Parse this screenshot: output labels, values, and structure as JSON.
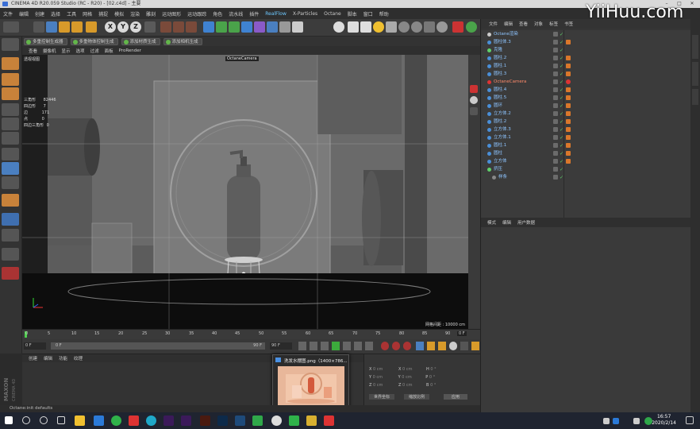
{
  "window": {
    "title": "CINEMA 4D R20.059 Studio (RC - R20) - [02.c4d] - 主要",
    "watermark": "YiiHuu.com"
  },
  "menubar": [
    "文件",
    "编辑",
    "创建",
    "选择",
    "工具",
    "网格",
    "捕捉",
    "模拟",
    "渲染",
    "雕刻",
    "运动图形",
    "运动跟踪",
    "角色",
    "流水线",
    "插件",
    "RealFlow",
    "X-Particles",
    "Octane",
    "脚本",
    "窗口",
    "帮助"
  ],
  "subtoolbar": [
    "多重控制生成器",
    "多重物体控制生成",
    "添加材质生成",
    "添加相机生成"
  ],
  "viewport": {
    "menu": [
      "查看",
      "摄像机",
      "显示",
      "选项",
      "过滤",
      "面板",
      "ProRender"
    ],
    "view_name": "透视视图",
    "camera_label": "OctaneCamera",
    "grid_distance": "网格间距 : 10000 cm",
    "stats": [
      {
        "label": "三角形",
        "value": "82446"
      },
      {
        "label": "四边形",
        "value": "7"
      },
      {
        "label": "边",
        "value": "171"
      },
      {
        "label": "点",
        "value": "0"
      },
      {
        "label": "四边三角形",
        "value": "0"
      }
    ],
    "colors": {
      "bg": "#000000",
      "wall": "#6e6e6e",
      "floor": "#141414"
    }
  },
  "timeline": {
    "ticks": [
      "0",
      "5",
      "10",
      "15",
      "20",
      "25",
      "30",
      "35",
      "40",
      "45",
      "50",
      "55",
      "60",
      "65",
      "70",
      "75",
      "80",
      "85",
      "90"
    ],
    "current_frame": "0 F",
    "start_field": "0 F",
    "start_field2": "0 F",
    "end_field": "90 F",
    "end_field2": "90 F"
  },
  "material_panel": {
    "menu": [
      "创建",
      "编辑",
      "功能",
      "纹理"
    ]
  },
  "coordinates": {
    "rows": [
      {
        "a": "X",
        "av": "0 cm",
        "b": "X",
        "bv": "0 cm",
        "c": "H",
        "cv": "0 °"
      },
      {
        "a": "Y",
        "av": "0 cm",
        "b": "Y",
        "bv": "0 cm",
        "c": "P",
        "cv": "0 °"
      },
      {
        "a": "Z",
        "av": "0 cm",
        "b": "Z",
        "bv": "0 cm",
        "c": "B",
        "cv": "0 °"
      }
    ],
    "mode1": "世界坐标",
    "mode2": "缩放比例",
    "apply": "应用"
  },
  "popup": {
    "title": "洗发水摆图.png（1400×786..."
  },
  "object_manager": {
    "menu": [
      "文件",
      "编辑",
      "查看",
      "对象",
      "标签",
      "书签"
    ],
    "items": [
      {
        "name": "Octane渲染",
        "indent": 0
      },
      {
        "name": "圆柱体.3",
        "indent": 0
      },
      {
        "name": "克隆",
        "indent": 0
      },
      {
        "name": "圆柱.2",
        "indent": 0
      },
      {
        "name": "圆柱.1",
        "indent": 0
      },
      {
        "name": "圆柱.3",
        "indent": 0
      },
      {
        "name": "OctaneCamera",
        "indent": 0
      },
      {
        "name": "圆柱.4",
        "indent": 0
      },
      {
        "name": "圆柱.5",
        "indent": 0
      },
      {
        "name": "圆环",
        "indent": 0
      },
      {
        "name": "立方体.2",
        "indent": 0
      },
      {
        "name": "圆柱.2",
        "indent": 0
      },
      {
        "name": "立方体.3",
        "indent": 0
      },
      {
        "name": "立方体.1",
        "indent": 0
      },
      {
        "name": "圆柱.1",
        "indent": 0
      },
      {
        "name": "圆柱",
        "indent": 0
      },
      {
        "name": "立方体",
        "indent": 0
      },
      {
        "name": "挤压",
        "indent": 0
      },
      {
        "name": "样条",
        "indent": 1
      }
    ]
  },
  "attribute_manager": {
    "menu": [
      "模式",
      "编辑",
      "用户数据"
    ]
  },
  "statusbar": "Octane:init defaults",
  "taskbar": {
    "time": "16:57",
    "date": "2020/2/14"
  }
}
